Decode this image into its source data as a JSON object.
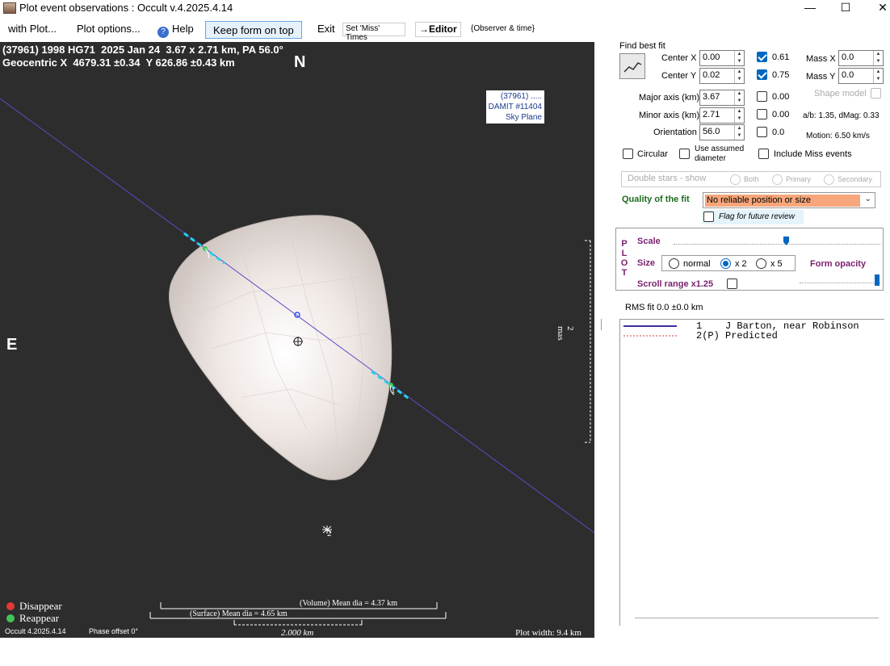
{
  "window": {
    "title": "Plot event observations : Occult v.4.2025.4.14",
    "minimize": "—",
    "maximize": "☐",
    "close": "✕"
  },
  "menu": {
    "with_plot": "with Plot...",
    "plot_options": "Plot options...",
    "help": "Help",
    "keep_on_top": "Keep form on top",
    "exit": "Exit",
    "set_miss_times": "Set 'Miss' Times",
    "editor": "→Editor",
    "observer_time": "{Observer & time}"
  },
  "plot": {
    "header_line1": "(37961) 1998 HG71  2025 Jan 24  3.67 x 2.71 km, PA 56.0°",
    "header_line2": "Geocentric X  4679.31 ±0.34  Y 626.86 ±0.43 km",
    "north": "N",
    "east": "E",
    "info_line1": "(37961) .....",
    "info_line2": "DAMIT #11404",
    "info_line3": "Sky Plane",
    "chord1_label": "1",
    "chord2_label": "2",
    "mas_label": "2 mas",
    "legend_disappear": "Disappear",
    "legend_reappear": "Reappear",
    "volume_mean": "(Volume) Mean dia = 4.37 km",
    "surface_mean": "(Surface) Mean dia = 4.65 km",
    "version": "Occult 4.2025.4.14",
    "phase_offset": "Phase offset 0°",
    "scale_km": "2.000 km",
    "plot_width": "Plot width: 9.4 km",
    "colors": {
      "disappear": "#e53935",
      "reappear": "#43c559",
      "chord": "#5b4bc4",
      "chord_edge": "#22d3ee"
    }
  },
  "fit": {
    "find_best_fit": "Find best fit",
    "center_x_label": "Center X",
    "center_x": "0.00",
    "center_x_uncert": "0.61",
    "center_y_label": "Center Y",
    "center_y": "0.02",
    "center_y_uncert": "0.75",
    "mass_x_label": "Mass X",
    "mass_x": "0.0",
    "mass_y_label": "Mass Y",
    "mass_y": "0.0",
    "shape_model": "Shape model",
    "major_label": "Major axis (km)",
    "major": "3.67",
    "major_uncert": "0.00",
    "minor_label": "Minor axis (km)",
    "minor": "2.71",
    "minor_uncert": "0.00",
    "ab_dmag": "a/b: 1.35, dMag: 0.33",
    "orientation_label": "Orientation",
    "orientation": "56.0",
    "orientation_uncert": "0.0",
    "motion": "Motion: 6.50 km/s",
    "circular": "Circular",
    "use_assumed_1": "Use assumed",
    "use_assumed_2": "diameter",
    "include_miss": "Include Miss events",
    "double_stars": "Double stars - show",
    "both": "Both",
    "primary": "Primary",
    "secondary": "Secondary",
    "quality_label": "Quality of the fit",
    "quality_value": "No reliable position or size",
    "flag_review": "Flag for future review"
  },
  "plotctl": {
    "vertical": [
      "P",
      "L",
      "O",
      "T"
    ],
    "scale": "Scale",
    "size": "Size",
    "normal": "normal",
    "x2": "x 2",
    "x5": "x 5",
    "form_opacity": "Form opacity",
    "scroll_range": "Scroll range x1.25"
  },
  "rms": "RMS fit  0.0 ±0.0 km",
  "observers": [
    {
      "num": "1",
      "text": "    J Barton, near Robinson"
    },
    {
      "num": "2(P)",
      "text": " Predicted"
    }
  ]
}
